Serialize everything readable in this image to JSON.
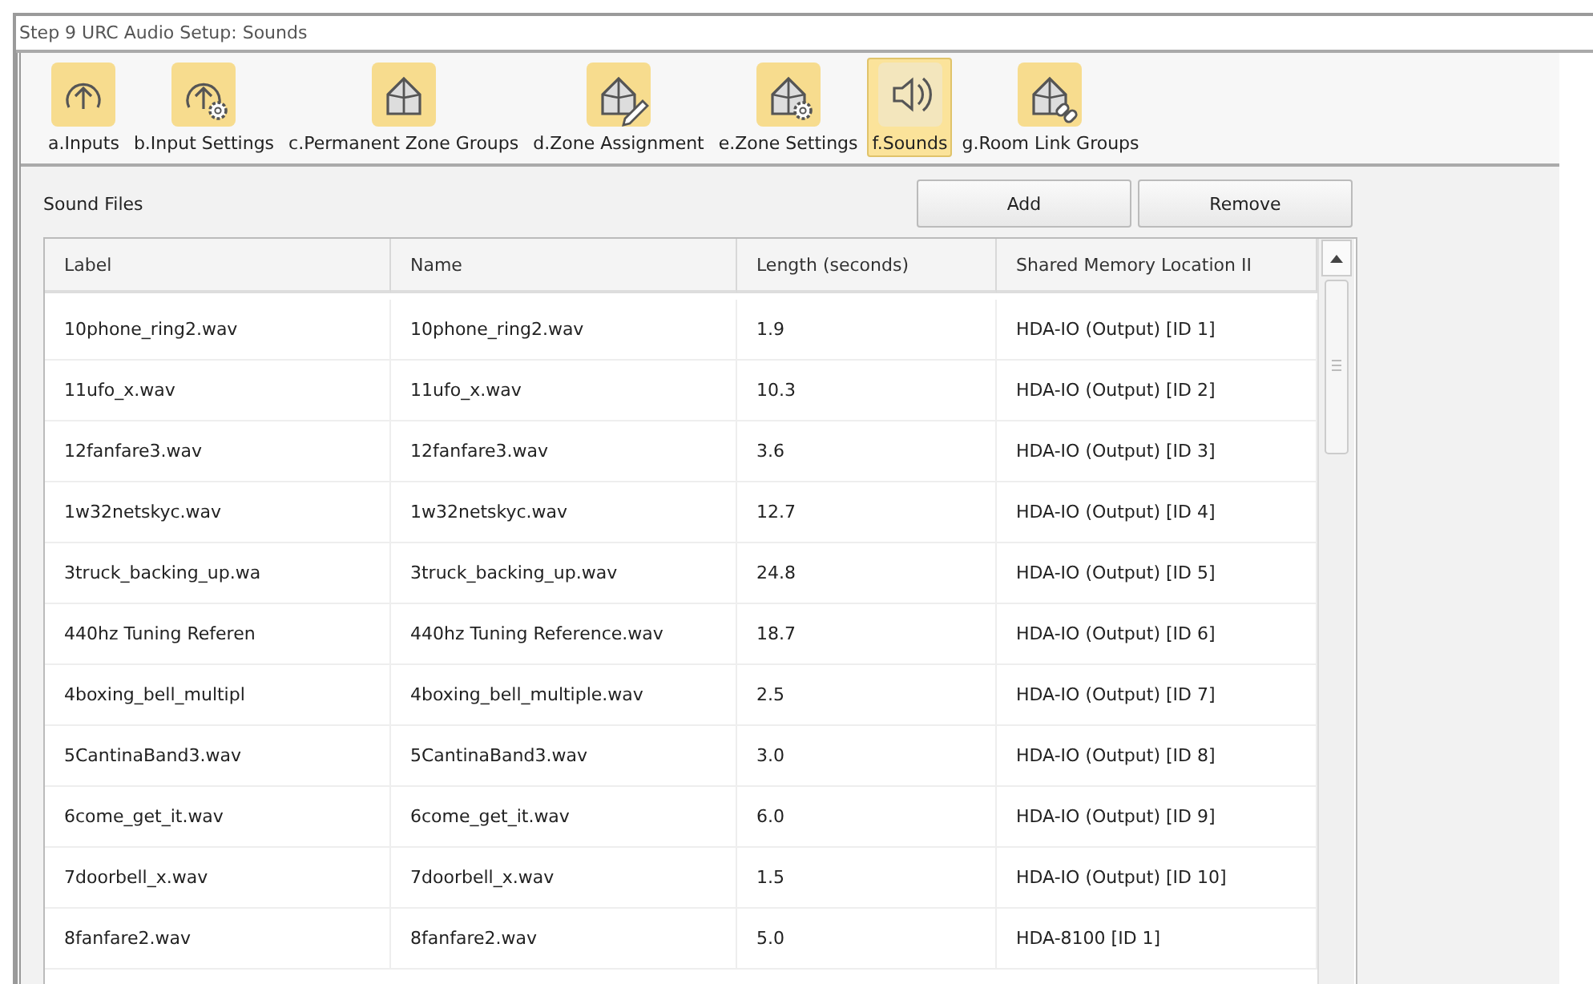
{
  "window": {
    "title": "Step 9 URC Audio Setup: Sounds"
  },
  "tabs": [
    {
      "label": "a.Inputs",
      "kind": "input",
      "selected": false
    },
    {
      "label": "b.Input Settings",
      "kind": "inputgear",
      "selected": false
    },
    {
      "label": "c.Permanent Zone Groups",
      "kind": "house",
      "selected": false
    },
    {
      "label": "d.Zone Assignment",
      "kind": "housepen",
      "selected": false
    },
    {
      "label": "e.Zone Settings",
      "kind": "housegear",
      "selected": false
    },
    {
      "label": "f.Sounds",
      "kind": "speaker",
      "selected": true
    },
    {
      "label": "g.Room Link Groups",
      "kind": "houselink",
      "selected": false
    }
  ],
  "panel": {
    "title": "Sound Files",
    "buttons": [
      "Add",
      "Remove"
    ]
  },
  "table": {
    "columns": [
      "Label",
      "Name",
      "Length (seconds)",
      "Shared Memory Location II"
    ],
    "rows": [
      [
        "10phone_ring2.wav",
        "10phone_ring2.wav",
        "1.9",
        "HDA-IO (Output) [ID 1]"
      ],
      [
        "11ufo_x.wav",
        "11ufo_x.wav",
        "10.3",
        "HDA-IO (Output) [ID 2]"
      ],
      [
        "12fanfare3.wav",
        "12fanfare3.wav",
        "3.6",
        "HDA-IO (Output) [ID 3]"
      ],
      [
        "1w32netskyc.wav",
        "1w32netskyc.wav",
        "12.7",
        "HDA-IO (Output) [ID 4]"
      ],
      [
        "3truck_backing_up.wa",
        "3truck_backing_up.wav",
        "24.8",
        "HDA-IO (Output) [ID 5]"
      ],
      [
        "440hz Tuning Referen",
        "440hz Tuning Reference.wav",
        "18.7",
        "HDA-IO (Output) [ID 6]"
      ],
      [
        "4boxing_bell_multipl",
        "4boxing_bell_multiple.wav",
        "2.5",
        "HDA-IO (Output) [ID 7]"
      ],
      [
        "5CantinaBand3.wav",
        "5CantinaBand3.wav",
        "3.0",
        "HDA-IO (Output) [ID 8]"
      ],
      [
        "6come_get_it.wav",
        "6come_get_it.wav",
        "6.0",
        "HDA-IO (Output) [ID 9]"
      ],
      [
        "7doorbell_x.wav",
        "7doorbell_x.wav",
        "1.5",
        "HDA-IO (Output) [ID 10]"
      ],
      [
        "8fanfare2.wav",
        "8fanfare2.wav",
        "5.0",
        "HDA-8100 [ID 1]"
      ]
    ]
  }
}
